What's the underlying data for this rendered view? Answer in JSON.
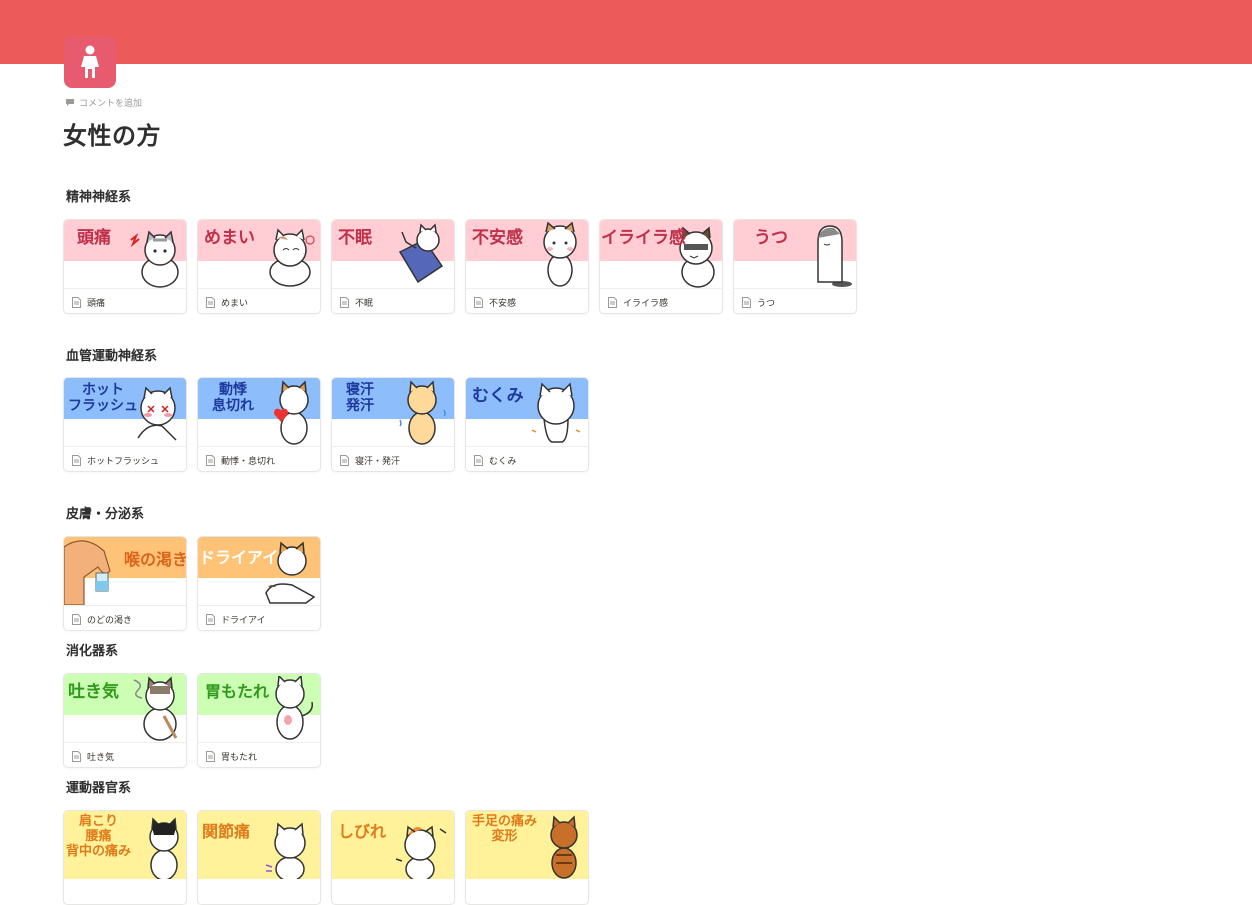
{
  "page": {
    "title": "女性の方",
    "comment_label": "コメントを追加",
    "icon": "woman-icon"
  },
  "colors": {
    "cover": "#ec5a5a",
    "icon_bg": "#e85a6e",
    "pink": "#ffcdd3",
    "blue": "#8dbdfb",
    "orange": "#ffc378",
    "green": "#ccffb3",
    "yellow": "#fff29a"
  },
  "sections": [
    {
      "title": "精神神経系",
      "cards": [
        {
          "thumb": "頭痛",
          "label": "頭痛"
        },
        {
          "thumb": "めまい",
          "label": "めまい"
        },
        {
          "thumb": "不眠",
          "label": "不眠"
        },
        {
          "thumb": "不安感",
          "label": "不安感"
        },
        {
          "thumb": "イライラ感",
          "label": "イライラ感"
        },
        {
          "thumb": "うつ",
          "label": "うつ"
        }
      ]
    },
    {
      "title": "血管運動神経系",
      "cards": [
        {
          "thumb": "ホット\nフラッシュ",
          "label": "ホットフラッシュ"
        },
        {
          "thumb": "動悸\n息切れ",
          "label": "動悸・息切れ"
        },
        {
          "thumb": "寝汗\n発汗",
          "label": "寝汗・発汗"
        },
        {
          "thumb": "むくみ",
          "label": "むくみ"
        }
      ]
    },
    {
      "title": "皮膚・分泌系",
      "cards": [
        {
          "thumb": "喉の渇き",
          "label": "のどの渇き"
        },
        {
          "thumb": "ドライアイ",
          "label": "ドライアイ"
        }
      ]
    },
    {
      "title": "消化器系",
      "cards": [
        {
          "thumb": "吐き気",
          "label": "吐き気"
        },
        {
          "thumb": "胃もたれ",
          "label": "胃もたれ"
        }
      ]
    },
    {
      "title": "運動器官系",
      "cards": [
        {
          "thumb": "肩こり\n腰痛\n背中の痛み",
          "label": ""
        },
        {
          "thumb": "関節痛",
          "label": ""
        },
        {
          "thumb": "しびれ",
          "label": ""
        },
        {
          "thumb": "手足の痛み\n変形",
          "label": ""
        }
      ]
    }
  ]
}
